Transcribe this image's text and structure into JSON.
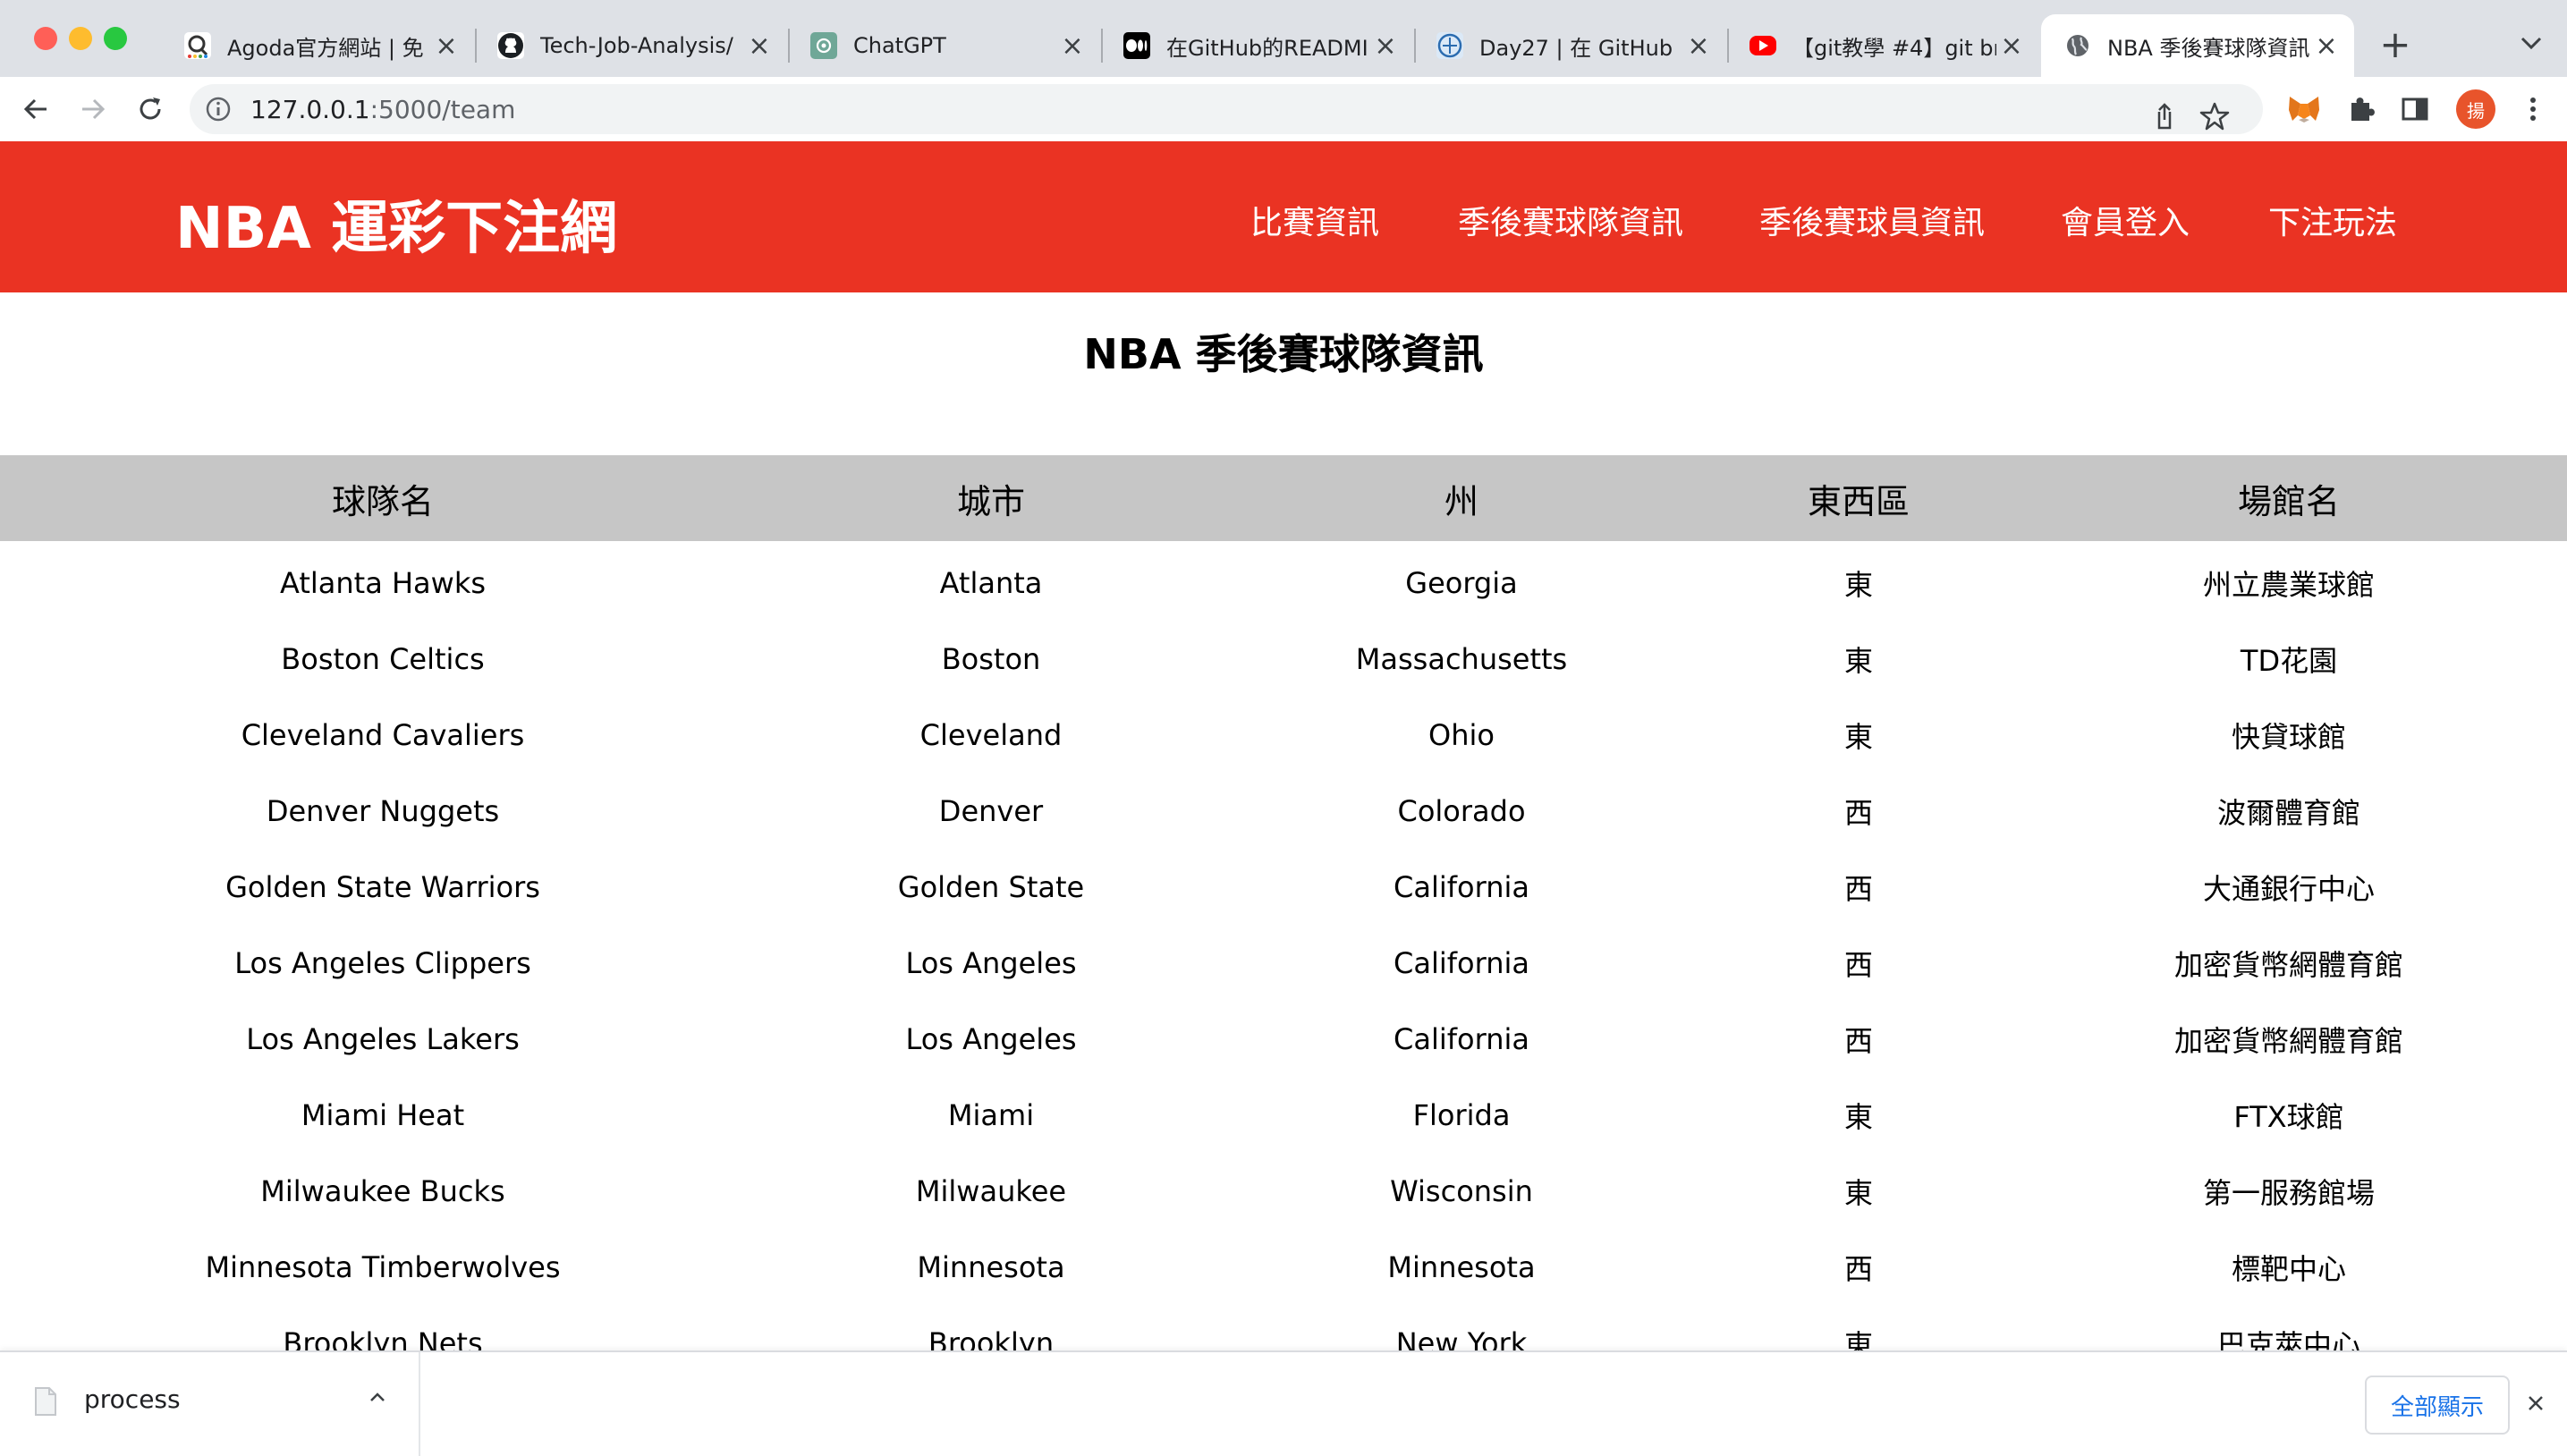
{
  "browser": {
    "tabs": [
      {
        "title": "Agoda官方網站 | 免",
        "favicon": "agoda-icon"
      },
      {
        "title": "Tech-Job-Analysis/",
        "favicon": "github-icon"
      },
      {
        "title": "ChatGPT",
        "favicon": "chatgpt-icon"
      },
      {
        "title": "在GitHub的READMI",
        "favicon": "medium-icon"
      },
      {
        "title": "Day27 | 在 GitHub",
        "favicon": "ithome-icon"
      },
      {
        "title": "【git教學 #4】git br",
        "favicon": "youtube-icon"
      },
      {
        "title": "NBA 季後賽球隊資訊",
        "favicon": "globe-icon",
        "active": true
      }
    ],
    "url_host": "127.0.0.1",
    "url_rest": ":5000/team",
    "profile_initial": "揚"
  },
  "site": {
    "brand": "NBA 運彩下注網",
    "nav": [
      "比賽資訊",
      "季後賽球隊資訊",
      "季後賽球員資訊",
      "會員登入",
      "下注玩法"
    ],
    "header_color": "#ea3323"
  },
  "page": {
    "title": "NBA 季後賽球隊資訊",
    "columns": [
      "球隊名",
      "城市",
      "州",
      "東西區",
      "場館名"
    ],
    "rows": [
      [
        "Atlanta Hawks",
        "Atlanta",
        "Georgia",
        "東",
        "州立農業球館"
      ],
      [
        "Boston Celtics",
        "Boston",
        "Massachusetts",
        "東",
        "TD花園"
      ],
      [
        "Cleveland Cavaliers",
        "Cleveland",
        "Ohio",
        "東",
        "快貸球館"
      ],
      [
        "Denver Nuggets",
        "Denver",
        "Colorado",
        "西",
        "波爾體育館"
      ],
      [
        "Golden State Warriors",
        "Golden State",
        "California",
        "西",
        "大通銀行中心"
      ],
      [
        "Los Angeles Clippers",
        "Los Angeles",
        "California",
        "西",
        "加密貨幣網體育館"
      ],
      [
        "Los Angeles Lakers",
        "Los Angeles",
        "California",
        "西",
        "加密貨幣網體育館"
      ],
      [
        "Miami Heat",
        "Miami",
        "Florida",
        "東",
        "FTX球館"
      ],
      [
        "Milwaukee Bucks",
        "Milwaukee",
        "Wisconsin",
        "東",
        "第一服務館場"
      ],
      [
        "Minnesota Timberwolves",
        "Minnesota",
        "Minnesota",
        "西",
        "標靶中心"
      ],
      [
        "Brooklyn Nets",
        "Brooklyn",
        "New York",
        "東",
        "巴克萊中心"
      ]
    ]
  },
  "download_bar": {
    "file_name": "process",
    "show_all_label": "全部顯示"
  }
}
